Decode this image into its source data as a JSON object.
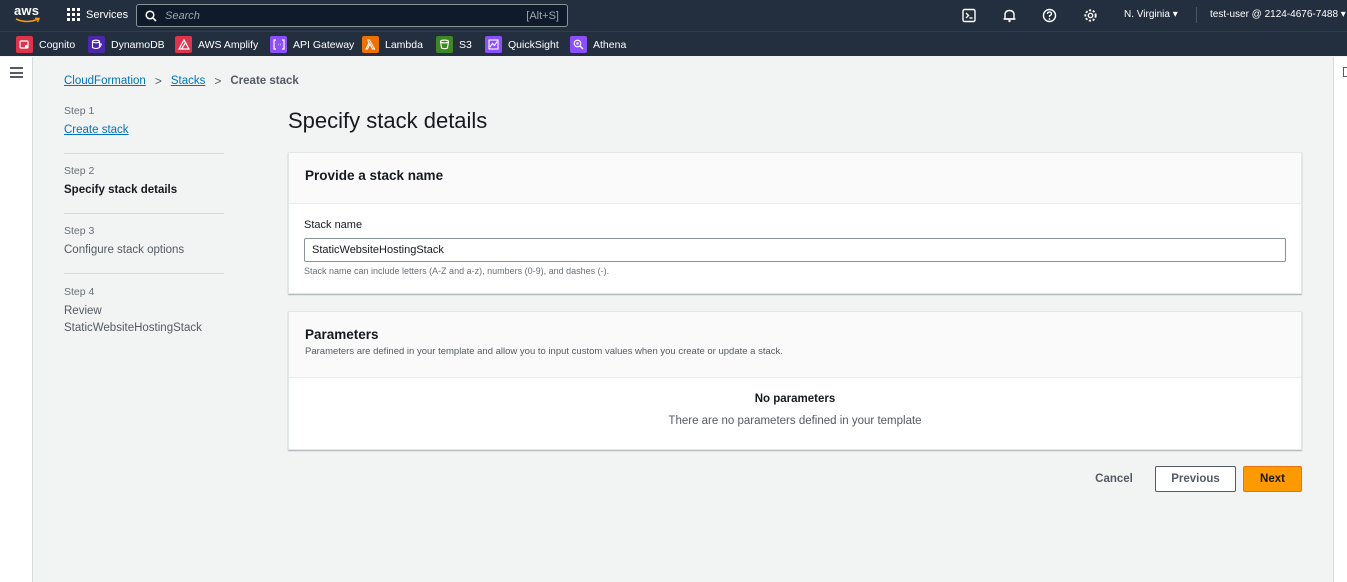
{
  "topnav": {
    "logo_text": "aws",
    "services_label": "Services",
    "search_placeholder": "Search",
    "search_shortcut": "[Alt+S]",
    "region": "N. Virginia ▾",
    "account": "test-user @ 2124-4676-7488 ▾",
    "icons": [
      "cloudshell-icon",
      "bell-icon",
      "help-icon",
      "settings-icon"
    ]
  },
  "favorites": [
    {
      "label": "Cognito",
      "color": "#dd344c"
    },
    {
      "label": "DynamoDB",
      "color": "#4d27aa"
    },
    {
      "label": "AWS Amplify",
      "color": "#dd344c"
    },
    {
      "label": "API Gateway",
      "color": "#8c4fff"
    },
    {
      "label": "Lambda",
      "color": "#ed7100"
    },
    {
      "label": "S3",
      "color": "#3f8624"
    },
    {
      "label": "QuickSight",
      "color": "#8c4fff"
    },
    {
      "label": "Athena",
      "color": "#8c4fff"
    }
  ],
  "breadcrumb": {
    "items": [
      "CloudFormation",
      "Stacks"
    ],
    "current": "Create stack"
  },
  "steps": [
    {
      "num": "Step 1",
      "label": "Create stack",
      "state": "link"
    },
    {
      "num": "Step 2",
      "label": "Specify stack details",
      "state": "active"
    },
    {
      "num": "Step 3",
      "label": "Configure stack options",
      "state": "muted"
    },
    {
      "num": "Step 4",
      "label": "Review",
      "sub": "StaticWebsiteHostingStack",
      "state": "muted"
    }
  ],
  "main": {
    "title": "Specify stack details",
    "name_panel": {
      "header": "Provide a stack name",
      "field_label": "Stack name",
      "field_value": "StaticWebsiteHostingStack",
      "field_hint": "Stack name can include letters (A-Z and a-z), numbers (0-9), and dashes (-)."
    },
    "params_panel": {
      "header": "Parameters",
      "description": "Parameters are defined in your template and allow you to input custom values when you create or update a stack.",
      "empty_title": "No parameters",
      "empty_desc": "There are no parameters defined in your template"
    }
  },
  "actions": {
    "cancel": "Cancel",
    "previous": "Previous",
    "next": "Next"
  },
  "colors": {
    "accent": "#ff9900",
    "link": "#0073bb",
    "nav_bg": "#232f3e"
  }
}
